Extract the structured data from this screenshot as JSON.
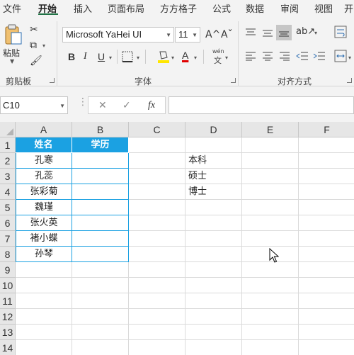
{
  "menu_tabs": [
    "文件",
    "开始",
    "插入",
    "页面布局",
    "方方格子",
    "公式",
    "数据",
    "审阅",
    "视图",
    "开"
  ],
  "ribbon": {
    "clipboard": {
      "paste_label": "粘贴",
      "group_label": "剪贴板"
    },
    "font": {
      "font_name": "Microsoft YaHei UI",
      "font_size": "11",
      "bold": "B",
      "italic": "I",
      "underline": "U",
      "grow_font": "A^",
      "shrink_font": "Aˇ",
      "font_color_glyph": "A",
      "phonetic": "wén",
      "phonetic_sub": "文",
      "group_label": "字体"
    },
    "alignment": {
      "group_label": "对齐方式"
    }
  },
  "formula_bar": {
    "name_box": "C10",
    "cancel_glyph": "✕",
    "enter_glyph": "✓",
    "fx_glyph": "fx",
    "formula": ""
  },
  "sheet": {
    "columns": [
      "A",
      "B",
      "C",
      "D",
      "E",
      "F"
    ],
    "rows": [
      "1",
      "2",
      "3",
      "4",
      "5",
      "6",
      "7",
      "8",
      "9",
      "10",
      "11",
      "12",
      "13",
      "14"
    ],
    "table_header": [
      "姓名",
      "学历"
    ],
    "names": [
      "孔寒",
      "孔蕊",
      "张彩菊",
      "魏瑾",
      "张火英",
      "褚小蝶",
      "孙琴"
    ],
    "education_options": [
      "本科",
      "硕士",
      "博士"
    ]
  },
  "colors": {
    "accent_excel": "#217346",
    "table_header_bg": "#1ba1e2",
    "table_border": "#1ba1e2",
    "font_color_underline": "#e00000",
    "highlight_underline": "#ffe600"
  }
}
